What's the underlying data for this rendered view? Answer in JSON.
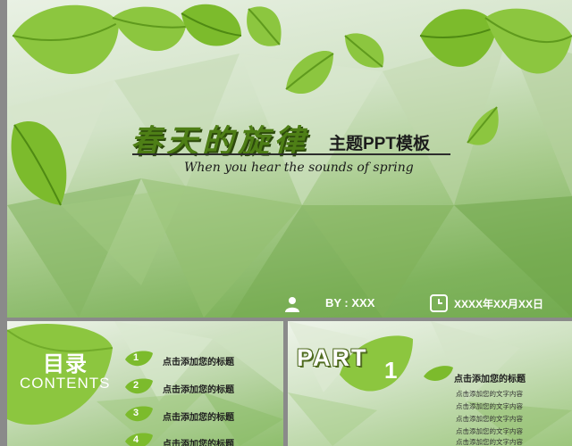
{
  "main_slide": {
    "title": "春天的旋律",
    "subtitle": "主题PPT模板",
    "tagline": "When you hear the sounds of spring",
    "author": "BY : XXX",
    "date": "XXXX年XX月XX日",
    "icons": {
      "author": "person-icon",
      "date": "clock-icon"
    },
    "colors": {
      "leaf": "#8cc63f",
      "leaf_dark": "#5f9a1d",
      "title": "#4e7f16"
    }
  },
  "toc_slide": {
    "title": "目录",
    "subtitle": "CONTENTS",
    "items": [
      {
        "num": "1",
        "label": "点击添加您的标题"
      },
      {
        "num": "2",
        "label": "点击添加您的标题"
      },
      {
        "num": "3",
        "label": "点击添加您的标题"
      },
      {
        "num": "4",
        "label": "点击添加您的标题"
      }
    ]
  },
  "part_slide": {
    "part": "PART",
    "number": "1",
    "heading": "点击添加您的标题",
    "lines": [
      "点击添加您的文字内容",
      "点击添加您的文字内容",
      "点击添加您的文字内容",
      "点击添加您的文字内容",
      "点击添加您的文字内容"
    ]
  }
}
